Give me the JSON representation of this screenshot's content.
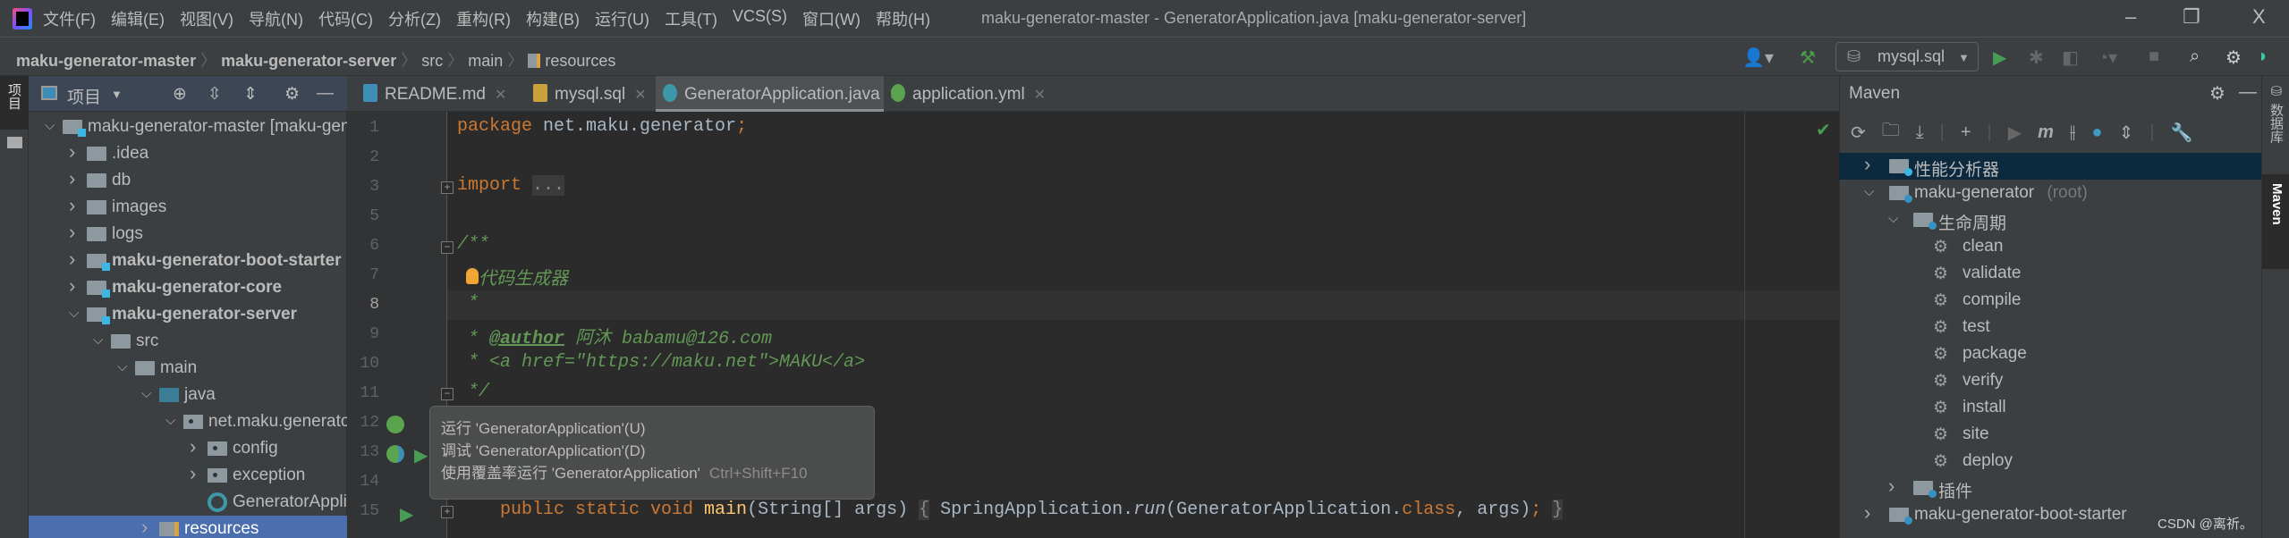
{
  "menu": [
    "文件(F)",
    "编辑(E)",
    "视图(V)",
    "导航(N)",
    "代码(C)",
    "分析(Z)",
    "重构(R)",
    "构建(B)",
    "运行(U)",
    "工具(T)",
    "VCS(S)",
    "窗口(W)",
    "帮助(H)"
  ],
  "window_title": "maku-generator-master - GeneratorApplication.java [maku-generator-server]",
  "window_controls": {
    "minimize": "–",
    "restore": "❐",
    "close": "X"
  },
  "breadcrumb": [
    "maku-generator-master",
    "maku-generator-server",
    "src",
    "main",
    "resources"
  ],
  "run_config": "mysql.sql",
  "left_stripe": {
    "project": "项目"
  },
  "project_panel": {
    "title": "项目"
  },
  "tree": [
    {
      "label": "maku-generator-master [maku-generator]",
      "level": 0,
      "chev": "v",
      "icon": "module",
      "bold": false
    },
    {
      "label": ".idea",
      "level": 1,
      "chev": ">",
      "icon": "folder"
    },
    {
      "label": "db",
      "level": 1,
      "chev": ">",
      "icon": "folder"
    },
    {
      "label": "images",
      "level": 1,
      "chev": ">",
      "icon": "folder"
    },
    {
      "label": "logs",
      "level": 1,
      "chev": ">",
      "icon": "folder"
    },
    {
      "label": "maku-generator-boot-starter",
      "level": 1,
      "chev": ">",
      "icon": "module",
      "bold": true
    },
    {
      "label": "maku-generator-core",
      "level": 1,
      "chev": ">",
      "icon": "module",
      "bold": true
    },
    {
      "label": "maku-generator-server",
      "level": 1,
      "chev": "v",
      "icon": "module",
      "bold": true
    },
    {
      "label": "src",
      "level": 2,
      "chev": "v",
      "icon": "folder"
    },
    {
      "label": "main",
      "level": 3,
      "chev": "v",
      "icon": "folder"
    },
    {
      "label": "java",
      "level": 4,
      "chev": "v",
      "icon": "src"
    },
    {
      "label": "net.maku.generator",
      "level": 5,
      "chev": "v",
      "icon": "package"
    },
    {
      "label": "config",
      "level": 6,
      "chev": ">",
      "icon": "package"
    },
    {
      "label": "exception",
      "level": 6,
      "chev": ">",
      "icon": "package"
    },
    {
      "label": "GeneratorApplication",
      "level": 6,
      "chev": "",
      "icon": "class"
    },
    {
      "label": "resources",
      "level": 4,
      "chev": ">",
      "icon": "resources",
      "selected": true
    }
  ],
  "tabs": [
    {
      "label": "README.md",
      "icon": "markdown-file",
      "active": false
    },
    {
      "label": "mysql.sql",
      "icon": "sql-file",
      "active": false
    },
    {
      "label": "GeneratorApplication.java",
      "icon": "spring-class",
      "active": true
    },
    {
      "label": "application.yml",
      "icon": "spring-config",
      "active": false
    }
  ],
  "code_lines": [
    {
      "n": "1",
      "tokens": [
        [
          "package ",
          "kw"
        ],
        [
          "net.maku.generator",
          ""
        ],
        [
          ";",
          "kw"
        ]
      ]
    },
    {
      "n": "2",
      "tokens": []
    },
    {
      "n": "3",
      "tokens": [
        [
          "import ",
          "kw"
        ],
        [
          "...",
          "fold"
        ]
      ]
    },
    {
      "n": "5",
      "tokens": []
    },
    {
      "n": "6",
      "tokens": [
        [
          "/**",
          "doc"
        ]
      ]
    },
    {
      "n": "7",
      "tokens": [
        [
          "  代码生成器",
          "doc"
        ]
      ]
    },
    {
      "n": "8",
      "tokens": [
        [
          " *",
          "doc"
        ]
      ]
    },
    {
      "n": "9",
      "tokens": [
        [
          " * ",
          "doc"
        ],
        [
          "@author",
          "tag"
        ],
        [
          " 阿沐 babamu@126.com",
          "doc"
        ]
      ]
    },
    {
      "n": "10",
      "tokens": [
        [
          " * <a href=\"https://maku.net\">MAKU</a>",
          "doc"
        ]
      ]
    },
    {
      "n": "11",
      "tokens": [
        [
          " */",
          "doc"
        ]
      ]
    },
    {
      "n": "12",
      "tokens": []
    },
    {
      "n": "13",
      "tokens": []
    },
    {
      "n": "14",
      "tokens": []
    },
    {
      "n": "15",
      "tokens": [
        [
          "    public static void ",
          "kw"
        ],
        [
          "main",
          "fn"
        ],
        [
          "(String[] args) ",
          ""
        ],
        [
          "{",
          "fold"
        ],
        [
          " SpringApplication.",
          ""
        ],
        [
          "run",
          "it"
        ],
        [
          "(GeneratorApplication.",
          ""
        ],
        [
          "class",
          "kw"
        ],
        [
          ", args)",
          ""
        ],
        [
          ";",
          "kw"
        ],
        [
          " ",
          ""
        ],
        [
          "}",
          "fold"
        ]
      ]
    }
  ],
  "tooltip": {
    "items": [
      {
        "label": "运行 'GeneratorApplication'(U)",
        "shortcut": ""
      },
      {
        "label": "调试 'GeneratorApplication'(D)",
        "shortcut": ""
      },
      {
        "label": "使用覆盖率运行 'GeneratorApplication'",
        "shortcut": "Ctrl+Shift+F10"
      }
    ]
  },
  "maven": {
    "title": "Maven",
    "rows": [
      {
        "label": "性能分析器",
        "level": 0,
        "chev": ">",
        "icon": "profiler",
        "selected": true
      },
      {
        "label": "maku-generator",
        "suffix": " (root)",
        "level": 0,
        "chev": "v",
        "icon": "maven-module"
      },
      {
        "label": "生命周期",
        "level": 1,
        "chev": "v",
        "icon": "lifecycle-folder"
      },
      {
        "label": "clean",
        "level": 2,
        "icon": "gear"
      },
      {
        "label": "validate",
        "level": 2,
        "icon": "gear"
      },
      {
        "label": "compile",
        "level": 2,
        "icon": "gear"
      },
      {
        "label": "test",
        "level": 2,
        "icon": "gear"
      },
      {
        "label": "package",
        "level": 2,
        "icon": "gear"
      },
      {
        "label": "verify",
        "level": 2,
        "icon": "gear"
      },
      {
        "label": "install",
        "level": 2,
        "icon": "gear"
      },
      {
        "label": "site",
        "level": 2,
        "icon": "gear"
      },
      {
        "label": "deploy",
        "level": 2,
        "icon": "gear"
      },
      {
        "label": "插件",
        "level": 1,
        "chev": ">",
        "icon": "plugins-folder"
      },
      {
        "label": "maku-generator-boot-starter",
        "level": 0,
        "chev": ">",
        "icon": "maven-module"
      }
    ]
  },
  "right_stripe": {
    "database": "数据库",
    "maven": "Maven"
  },
  "watermark": "CSDN @离祈。",
  "colors": {
    "selection": "#4b6eaf",
    "keyword": "#cc7832",
    "doc_comment": "#629755",
    "editor_bg": "#2b2b2b",
    "panel_bg": "#3c3f41"
  }
}
